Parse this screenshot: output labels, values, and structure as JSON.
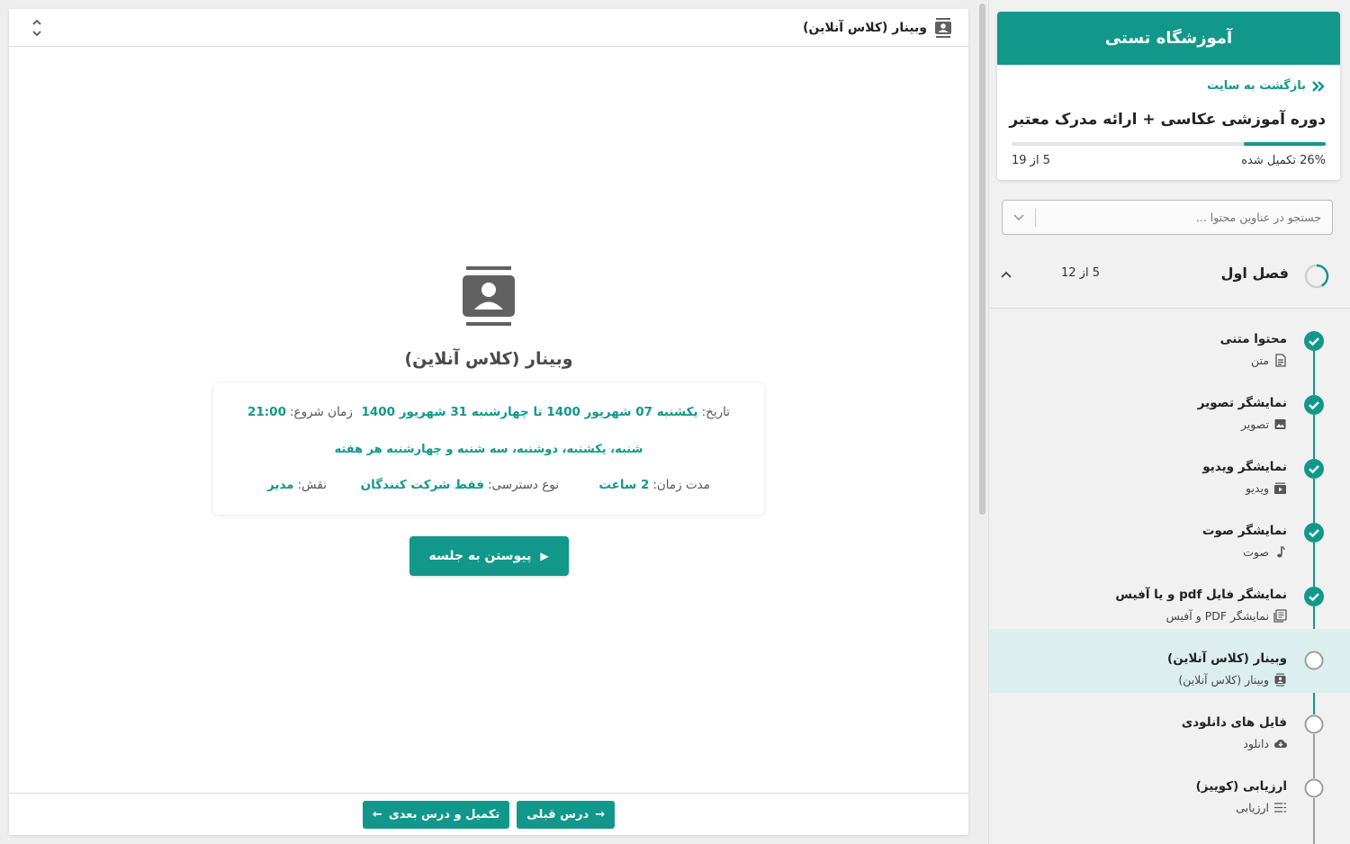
{
  "main": {
    "header_title": "وبینار (کلاس آنلاین)",
    "webinar_title": "وبینار (کلاس آنلاین)",
    "info": {
      "date_label": "تاریخ:",
      "date_value": "یکشنبه 07 شهریور 1400 تا چهارشنبه 31 شهریور 1400",
      "start_label": "زمان شروع:",
      "start_value": "21:00",
      "days": "شنبه، یکشنبه، دوشنبه، سه شنبه و چهارشنبه هر هفته",
      "duration_label": "مدت زمان:",
      "duration_value": "2 ساعت",
      "access_label": "نوع دسترسی:",
      "access_value": "فقط شرکت کنندگان",
      "role_label": "نقش:",
      "role_value": "مدیر"
    },
    "join_label": "پیوستن به جلسه",
    "prev_label": "درس قبلی",
    "next_label": "تکمیل و درس بعدی"
  },
  "sidebar": {
    "school_name": "آموزشگاه تستی",
    "back_label": "بازگشت به سایت",
    "course_title": "دوره آموزشی عکاسی + ارائه مدرک معتبر",
    "progress_percent": 26,
    "progress_text": "26% تکمیل شده",
    "progress_count": "5 از 19",
    "search_placeholder": "جستجو در عناوین محتوا ...",
    "chapter": {
      "title": "فصل اول",
      "count": "5 از 12"
    },
    "lessons": [
      {
        "title": "محتوا متنی",
        "type": "متن",
        "icon": "document-icon",
        "done": true,
        "active": false
      },
      {
        "title": "نمایشگر تصویر",
        "type": "تصویر",
        "icon": "image-icon",
        "done": true,
        "active": false
      },
      {
        "title": "نمایشگر ویدیو",
        "type": "ویدیو",
        "icon": "video-icon",
        "done": true,
        "active": false
      },
      {
        "title": "نمایشگر صوت",
        "type": "صوت",
        "icon": "music-note-icon",
        "done": true,
        "active": false
      },
      {
        "title": "نمایشگر فایل pdf و یا آفیس",
        "type": "نمایشگر PDF و آفیس",
        "icon": "pdf-icon",
        "done": true,
        "active": false
      },
      {
        "title": "وبینار (کلاس آنلاین)",
        "type": "وبینار (کلاس آنلاین)",
        "icon": "contact-card-icon",
        "done": false,
        "active": true
      },
      {
        "title": "فایل های دانلودی",
        "type": "دانلود",
        "icon": "cloud-download-icon",
        "done": false,
        "active": false
      },
      {
        "title": "ارزیابی (کوییز)",
        "type": "ارزیابی",
        "icon": "checklist-icon",
        "done": false,
        "active": false
      }
    ]
  },
  "colors": {
    "accent": "#12988a",
    "active_bg": "#dceeee",
    "pending": "#9e9e9e"
  }
}
